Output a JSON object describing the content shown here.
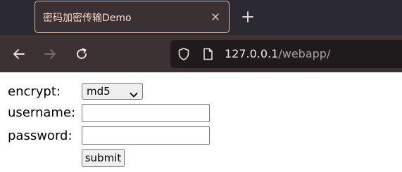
{
  "browser": {
    "tab_title": "密码加密传输Demo",
    "url_host": "127.0.0.1",
    "url_path": "/webapp/"
  },
  "form": {
    "encrypt_label": "encrypt:",
    "encrypt_selected": "md5",
    "username_label": "username:",
    "username_value": "",
    "password_label": "password:",
    "password_value": "",
    "submit_label": "submit"
  },
  "icons": {
    "tab_close": "close-icon",
    "new_tab": "plus-icon",
    "back": "arrow-left-icon",
    "forward": "arrow-right-icon",
    "reload": "reload-icon",
    "shield": "shield-icon",
    "page": "page-icon",
    "select_arrow": "chevron-down-icon"
  },
  "colors": {
    "tabbar_bg": "#2b2a33",
    "navbar_bg": "#3c3133",
    "urlbar_bg": "#1f1b1d",
    "tab_border": "#d8b7a5",
    "tab_text": "#f6dccc"
  }
}
